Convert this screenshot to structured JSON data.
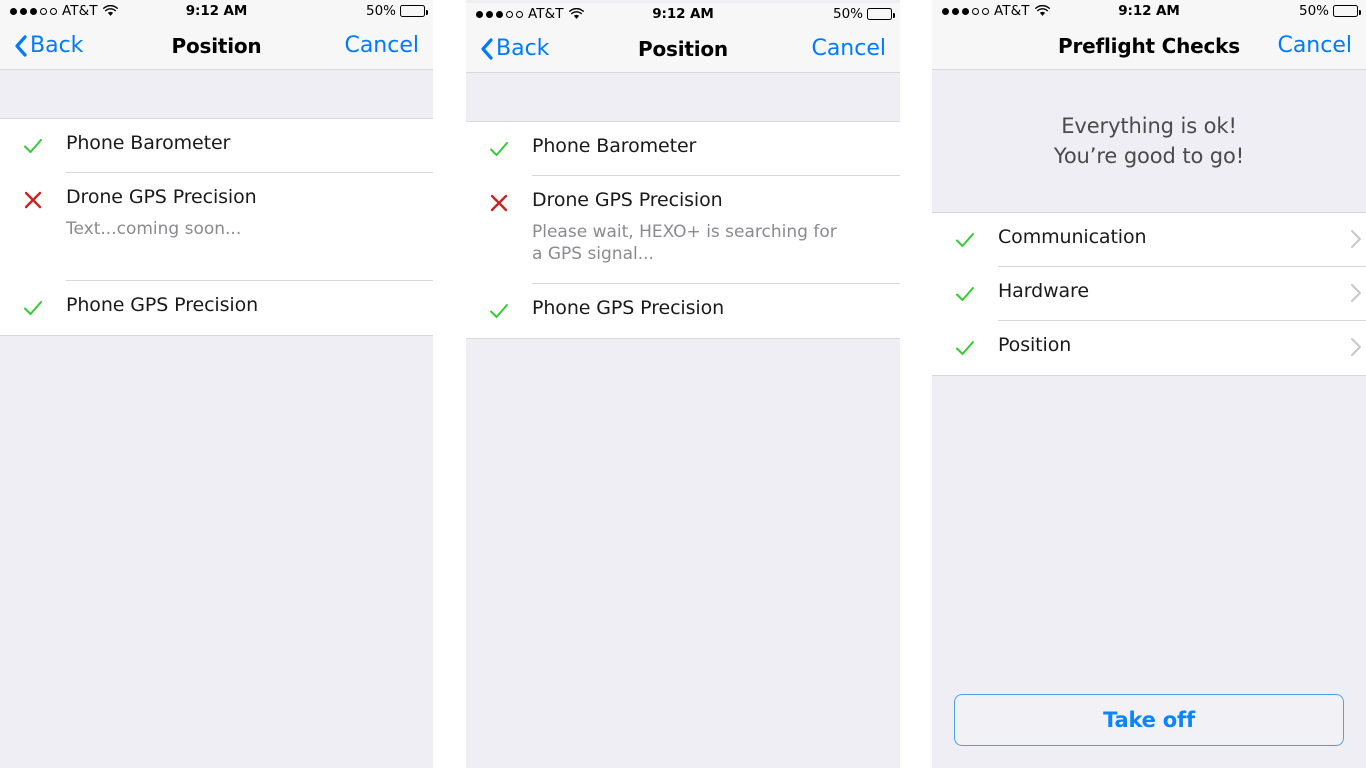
{
  "status_bar": {
    "carrier": "AT&T",
    "time": "9:12 AM",
    "battery_percent": "50%",
    "signal_filled_dots": 3,
    "signal_empty_dots": 2,
    "wifi_icon": "wifi-icon",
    "battery_icon": "battery-icon"
  },
  "colors": {
    "accent_blue": "#007AFF",
    "check_green": "#33CC33",
    "error_red": "#CC2222",
    "nav_bg": "#F7F7F8",
    "group_bg": "#EFEEF4",
    "separator": "#D8D8DC",
    "subtitle_gray": "#8A8A8F",
    "button_border": "#4AA3E8"
  },
  "panels": [
    {
      "id": "position-panel-initial",
      "nav": {
        "back_label": "Back",
        "back_icon": "chevron-left-icon",
        "title": "Position",
        "cancel_label": "Cancel"
      },
      "rows": [
        {
          "icon": "check-icon",
          "status": "ok",
          "title": "Phone Barometer",
          "subtitle": ""
        },
        {
          "icon": "x-icon",
          "status": "error",
          "title": "Drone GPS Precision",
          "subtitle": "Text...coming soon..."
        },
        {
          "icon": "check-icon",
          "status": "ok",
          "title": "Phone GPS Precision",
          "subtitle": ""
        }
      ]
    },
    {
      "id": "position-panel-searching",
      "nav": {
        "back_label": "Back",
        "back_icon": "chevron-left-icon",
        "title": "Position",
        "cancel_label": "Cancel"
      },
      "rows": [
        {
          "icon": "check-icon",
          "status": "ok",
          "title": "Phone Barometer",
          "subtitle": ""
        },
        {
          "icon": "x-icon",
          "status": "error",
          "title": "Drone GPS Precision",
          "subtitle": "Please wait, HEXO+ is searching for a GPS signal..."
        },
        {
          "icon": "check-icon",
          "status": "ok",
          "title": "Phone GPS Precision",
          "subtitle": ""
        }
      ]
    },
    {
      "id": "preflight-checks-panel",
      "nav": {
        "title": "Preflight Checks",
        "cancel_label": "Cancel"
      },
      "hero": {
        "line1": "Everything is ok!",
        "line2": "You’re good to go!"
      },
      "rows": [
        {
          "icon": "check-icon",
          "status": "ok",
          "title": "Communication",
          "chevron": "chevron-right-icon"
        },
        {
          "icon": "check-icon",
          "status": "ok",
          "title": "Hardware",
          "chevron": "chevron-right-icon"
        },
        {
          "icon": "check-icon",
          "status": "ok",
          "title": "Position",
          "chevron": "chevron-right-icon"
        }
      ],
      "takeoff_button": "Take off"
    }
  ]
}
